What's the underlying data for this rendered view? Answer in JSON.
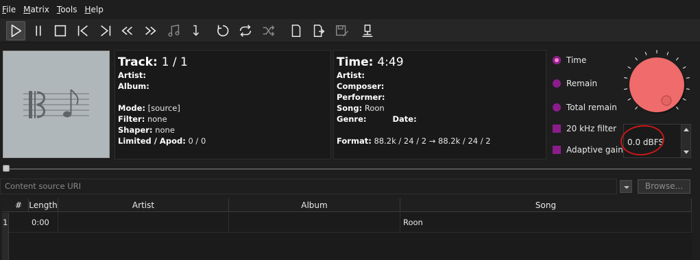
{
  "menubar": {
    "items": [
      {
        "first": "F",
        "rest": "ile"
      },
      {
        "first": "M",
        "rest": "atrix"
      },
      {
        "first": "T",
        "rest": "ools"
      },
      {
        "first": "H",
        "rest": "elp"
      }
    ]
  },
  "track": {
    "label": "Track:",
    "value": "1 / 1",
    "artist_label": "Artist:",
    "album_label": "Album:",
    "mode_label": "Mode:",
    "mode_value": "[source]",
    "filter_label": "Filter:",
    "filter_value": "none",
    "shaper_label": "Shaper:",
    "shaper_value": "none",
    "limited_label": "Limited / Apod:",
    "limited_value": "0 / 0"
  },
  "time": {
    "label": "Time:",
    "value": "4:49",
    "artist_label": "Artist:",
    "composer_label": "Composer:",
    "performer_label": "Performer:",
    "song_label": "Song:",
    "song_value": "Roon",
    "genre_label": "Genre:",
    "date_label": "Date:",
    "format_label": "Format:",
    "format_value": "88.2k / 24 / 2 → 88.2k / 24 / 2"
  },
  "options": {
    "radio_time": "Time",
    "radio_remain": "Remain",
    "radio_total": "Total remain",
    "check_filter": "20 kHz filter",
    "check_adaptive": "Adaptive gain",
    "selected": "Time"
  },
  "gain": {
    "value": "0.0 dBFS"
  },
  "seek": {
    "position": 0
  },
  "source": {
    "placeholder": "Content source URI",
    "browse_label": "Browse..."
  },
  "playlist": {
    "headers": [
      "#",
      "Length",
      "Artist",
      "Album",
      "Song"
    ],
    "rows": [
      {
        "num": "1",
        "length": "0:00",
        "artist": "",
        "album": "",
        "song": "Roon"
      }
    ]
  },
  "colors": {
    "accent": "#8b1d8b",
    "radio_selected": "#ff7fd0",
    "knob": "#f06b6b",
    "annotation": "#c81818"
  }
}
